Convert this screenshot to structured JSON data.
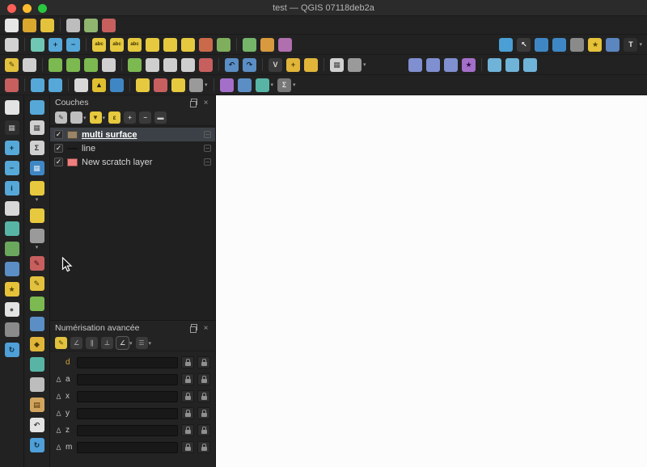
{
  "window": {
    "title": "test — QGIS 07118deb2a"
  },
  "ui": {
    "check": "✓",
    "close": "×",
    "dropdown_glyph": "▾"
  },
  "colors": {
    "selection": "#3c4147",
    "canvas": "#fcfcfc",
    "toolbar_bg": "#222222"
  },
  "toolbars": {
    "row1": [
      {
        "name": "new-project-icon",
        "color": "#e6e6e6"
      },
      {
        "name": "open-project-icon",
        "color": "#d9a62e"
      },
      {
        "name": "save-project-icon",
        "color": "#e4c23c"
      },
      {
        "sep": true
      },
      {
        "name": "new-print-layout-icon",
        "color": "#bdbdbd"
      },
      {
        "name": "layout-manager-icon",
        "color": "#8fb56f"
      },
      {
        "name": "style-manager-icon",
        "color": "#c75f5f"
      }
    ],
    "row2_left": [
      {
        "name": "data-source-manager-icon",
        "color": "#d2d2d2"
      },
      {
        "sep": true
      },
      {
        "name": "pan-map-icon",
        "color": "#6fc7b4"
      },
      {
        "name": "zoom-in-icon",
        "color": "#56a8d8",
        "glyph": "+",
        "fg": "#0c2a3a"
      },
      {
        "name": "zoom-out-icon",
        "color": "#56a8d8",
        "glyph": "−",
        "fg": "#0c2a3a"
      },
      {
        "sep": true
      },
      {
        "name": "layer-labeling-icon",
        "color": "#e6c93e",
        "glyph": "abc",
        "fg": "#3a3000"
      },
      {
        "name": "layer-diagram-icon",
        "color": "#e6c93e",
        "glyph": "abc",
        "fg": "#3a3000"
      },
      {
        "name": "highlight-labels-icon",
        "color": "#e6c93e",
        "glyph": "abc",
        "fg": "#3a3000"
      },
      {
        "name": "pin-labels-icon",
        "color": "#e6c93e"
      },
      {
        "name": "show-hide-labels-icon",
        "color": "#e6c93e"
      },
      {
        "name": "move-label-icon",
        "color": "#e6c93e"
      },
      {
        "name": "rotate-label-icon",
        "color": "#cb6a4a"
      },
      {
        "name": "change-label-icon",
        "color": "#7fae5c"
      },
      {
        "sep": true
      },
      {
        "name": "map-tips-icon",
        "color": "#74b56a"
      },
      {
        "name": "new-annotation-icon",
        "color": "#d99a3f"
      },
      {
        "name": "statistical-summary-icon",
        "color": "#b06fae"
      }
    ],
    "row2_right": [
      {
        "name": "processing-toolbox-icon",
        "color": "#4a9fd4"
      },
      {
        "name": "select-cursor-icon",
        "color": "#3a3a3a",
        "glyph": "↖",
        "fg": "#f0f0f0"
      },
      {
        "name": "select-features-icon",
        "color": "#3f87c4"
      },
      {
        "name": "select-by-form-icon",
        "color": "#3f87c4"
      },
      {
        "name": "deselect-all-icon",
        "color": "#8a8a8a"
      },
      {
        "name": "bookmark-star-icon",
        "color": "#e6c23a",
        "glyph": "★",
        "fg": "#5a4a00"
      },
      {
        "name": "python-console-icon",
        "color": "#5b86c0"
      },
      {
        "name": "text-annotation-icon",
        "color": "#2f2f2f",
        "glyph": "T",
        "fg": "#e8e8e8",
        "drop": true
      }
    ],
    "row3_left": [
      {
        "name": "toggle-editing-icon",
        "color": "#e2c13e",
        "glyph": "✎",
        "fg": "#4a3a00"
      },
      {
        "name": "save-edits-icon",
        "color": "#cfcfcf"
      },
      {
        "sep": true
      },
      {
        "name": "add-point-feature-icon",
        "color": "#7cb950"
      },
      {
        "name": "add-line-feature-icon",
        "color": "#7cb950"
      },
      {
        "name": "add-polygon-feature-icon",
        "color": "#7cb950"
      },
      {
        "name": "vertex-tool-icon",
        "color": "#d0d0d0"
      },
      {
        "sep": true
      },
      {
        "name": "move-feature-icon",
        "color": "#7cb950"
      },
      {
        "name": "copy-features-icon",
        "color": "#cfcfcf"
      },
      {
        "name": "cut-features-icon",
        "color": "#cfcfcf"
      },
      {
        "name": "paste-features-icon",
        "color": "#cfcfcf"
      },
      {
        "name": "delete-selected-icon",
        "color": "#c75f5f"
      },
      {
        "sep": true
      },
      {
        "name": "undo-icon",
        "color": "#5b8ec4",
        "glyph": "↶",
        "fg": "#0e2137"
      },
      {
        "name": "redo-icon",
        "color": "#5b8ec4",
        "glyph": "↷",
        "fg": "#0e2137"
      },
      {
        "sep": true
      },
      {
        "name": "vertex-editor-icon",
        "color": "#3a3a3a",
        "glyph": "V",
        "fg": "#d8d8d8"
      },
      {
        "name": "snapping-plus-icon",
        "color": "#e0b53a",
        "glyph": "+",
        "fg": "#4a3a00"
      },
      {
        "name": "tracing-icon",
        "color": "#e0b53a"
      },
      {
        "sep": true
      },
      {
        "name": "attribute-table-icon",
        "color": "#d0d0d0",
        "glyph": "▦",
        "fg": "#444444"
      },
      {
        "name": "layer-gear-icon",
        "color": "#9a9a9a",
        "drop": true
      }
    ],
    "row3_right": [
      {
        "name": "histogram-icon",
        "color": "#7f8fd0"
      },
      {
        "name": "bar-chart-icon",
        "color": "#7f8fd0"
      },
      {
        "name": "line-chart-icon",
        "color": "#7f8fd0"
      },
      {
        "name": "purple-star-icon",
        "color": "#a46fc8",
        "glyph": "★",
        "fg": "#2e0e48"
      },
      {
        "sep": true
      },
      {
        "name": "raster-stats-icon",
        "color": "#6fb3d8"
      },
      {
        "name": "raster-calc-icon",
        "color": "#6fb3d8"
      },
      {
        "name": "profile-tool-icon",
        "color": "#6fb3d8"
      }
    ],
    "row4": [
      {
        "name": "snapping-toggle-icon",
        "color": "#c75f5f"
      },
      {
        "sep": true
      },
      {
        "name": "zoom-next-icon",
        "color": "#56a8d8"
      },
      {
        "name": "zoom-last-icon",
        "color": "#56a8d8"
      },
      {
        "sep": true
      },
      {
        "name": "new-shapefile-icon",
        "color": "#d8d8d8"
      },
      {
        "name": "new-geopackage-icon",
        "color": "#e0c030",
        "glyph": "▲",
        "fg": "#222222"
      },
      {
        "name": "new-virtual-layer-icon",
        "color": "#3f87c4"
      },
      {
        "sep": true
      },
      {
        "name": "label-tool-icon",
        "color": "#e6c93e"
      },
      {
        "name": "diagram-tool-icon",
        "color": "#c75f5f"
      },
      {
        "name": "annotation-tool-icon",
        "color": "#e6c93e"
      },
      {
        "name": "form-annotation-icon",
        "color": "#9a9a9a",
        "drop": true
      },
      {
        "sep": true
      },
      {
        "name": "place-search-icon",
        "color": "#a46fc8"
      },
      {
        "name": "coordinate-capture-icon",
        "color": "#5b8ec4"
      },
      {
        "name": "measure-tool-icon",
        "color": "#58b5a5",
        "drop": true
      },
      {
        "name": "sum-tool-icon",
        "color": "#777777",
        "glyph": "Σ",
        "fg": "#dddddd",
        "drop": true
      }
    ]
  },
  "side_toolbar_1": [
    {
      "name": "pan-hand-icon",
      "color": "#e3e3e3"
    },
    {
      "name": "zoom-window-icon",
      "color": "#2f2f2f",
      "glyph": "▦",
      "fg": "#bbbbbb"
    },
    {
      "name": "zoom-in-mag-icon",
      "color": "#56a8d8",
      "glyph": "+",
      "fg": "#0c2a3a"
    },
    {
      "name": "zoom-out-mag-icon",
      "color": "#56a8d8",
      "glyph": "−",
      "fg": "#0c2a3a"
    },
    {
      "name": "identify-features-icon",
      "color": "#56a8d8",
      "glyph": "i",
      "fg": "#0c2a3a"
    },
    {
      "name": "select-rectangle-icon",
      "color": "#d8d8d8"
    },
    {
      "name": "measure-line-icon",
      "color": "#58b5a5"
    },
    {
      "name": "globe-green-icon",
      "color": "#6aa85e"
    },
    {
      "name": "globe-blue-icon",
      "color": "#5b8ec4"
    },
    {
      "name": "bookmark-icon",
      "color": "#e6c23a",
      "glyph": "★",
      "fg": "#5a4a00"
    },
    {
      "name": "temporal-clock-icon",
      "color": "#e3e3e3",
      "glyph": "●",
      "fg": "#555555"
    },
    {
      "name": "layers-db-icon",
      "color": "#8a8a8a"
    },
    {
      "name": "map-refresh-icon",
      "color": "#4f9fd8",
      "glyph": "↻",
      "fg": "#0c2a3a"
    }
  ],
  "side_toolbar_2": [
    {
      "name": "zoom-mag-2-icon",
      "color": "#56a8d8"
    },
    {
      "name": "attribute-table-2-icon",
      "color": "#d0d0d0",
      "glyph": "▦",
      "fg": "#444444"
    },
    {
      "name": "statistics-sum-icon",
      "color": "#d0d0d0",
      "glyph": "Σ",
      "fg": "#333333"
    },
    {
      "name": "blue-table-icon",
      "color": "#3f87c4",
      "glyph": "▦",
      "fg": "#dce9f5"
    },
    {
      "name": "callout-icon",
      "color": "#e6c93e",
      "drop": true
    },
    {
      "name": "map-tip-icon",
      "color": "#e6c93e"
    },
    {
      "name": "gear-icon",
      "color": "#9a9a9a",
      "drop": true
    },
    {
      "name": "edit-red-pencil-icon",
      "color": "#c75f5f",
      "glyph": "✎",
      "fg": "#3a0e0e"
    },
    {
      "name": "edit-yellow-pencil-icon",
      "color": "#e2c13e",
      "glyph": "✎",
      "fg": "#4a3a00"
    },
    {
      "name": "shape-green-icon",
      "color": "#7cb950"
    },
    {
      "name": "shape-blue-icon",
      "color": "#5b8ec4"
    },
    {
      "name": "diamond-icon",
      "color": "#e0b53a",
      "glyph": "◆",
      "fg": "#4a3a00"
    },
    {
      "name": "ruler-icon",
      "color": "#58b5a5"
    },
    {
      "name": "history-icon",
      "color": "#bdbdbd"
    },
    {
      "name": "clipboard-icon",
      "color": "#d2a55e",
      "glyph": "▤",
      "fg": "#4a2e00"
    },
    {
      "name": "undo-2-icon",
      "color": "#e3e3e3",
      "glyph": "↶",
      "fg": "#333333"
    },
    {
      "name": "redo-refresh-icon",
      "color": "#4f9fd8",
      "glyph": "↻",
      "fg": "#0c2a3a"
    }
  ],
  "layers_panel": {
    "title": "Couches",
    "toolbar": [
      {
        "name": "open-layer-styling-icon",
        "color": "#bfbfbf",
        "glyph": "✎",
        "fg": "#333333"
      },
      {
        "name": "manage-map-themes-icon",
        "color": "#bfbfbf",
        "drop": true
      },
      {
        "name": "filter-legend-icon",
        "color": "#e6c93e",
        "glyph": "▼",
        "fg": "#4a3a00",
        "drop": true
      },
      {
        "name": "filter-expression-icon",
        "color": "#e6c93e",
        "glyph": "ε",
        "fg": "#4a3a00"
      },
      {
        "name": "expand-all-icon",
        "color": "#3a3a3a",
        "glyph": "+",
        "fg": "#cccccc"
      },
      {
        "name": "collapse-all-icon",
        "color": "#3a3a3a",
        "glyph": "−",
        "fg": "#cccccc"
      },
      {
        "name": "remove-layer-icon",
        "color": "#3a3a3a",
        "glyph": "▬",
        "fg": "#cccccc"
      }
    ],
    "layers": [
      {
        "name": "multi surface",
        "check": "✓",
        "selected": true,
        "symbol_color": "#9b8568"
      },
      {
        "name": "line",
        "check": "✓",
        "selected": false,
        "symbol_color": "#141414"
      },
      {
        "name": "New scratch layer",
        "check": "✓",
        "selected": false,
        "symbol_color": "#ef7f7f"
      }
    ]
  },
  "digitizing_panel": {
    "title": "Numérisation avancée",
    "toolbar": [
      {
        "name": "enable-advanced-digitizing-icon",
        "color": "#e2c13e",
        "glyph": "✎",
        "fg": "#4a3a00"
      },
      {
        "name": "construction-mode-icon",
        "color": "#3a3a3a",
        "glyph": "∠",
        "fg": "#999999"
      },
      {
        "name": "parallel-icon",
        "color": "#3a3a3a",
        "glyph": "∥",
        "fg": "#999999"
      },
      {
        "name": "perpendicular-icon",
        "color": "#3a3a3a",
        "glyph": "⊥",
        "fg": "#999999"
      },
      {
        "name": "snap-common-angles-icon",
        "color": "#2b2b2b",
        "glyph": "∠",
        "fg": "#cccccc",
        "drop": true,
        "pressed": true
      },
      {
        "name": "construction-guides-icon",
        "color": "#3a3a3a",
        "glyph": "☰",
        "fg": "#999999",
        "drop": true
      }
    ],
    "rows": [
      {
        "label": "d",
        "delta_glyph": "",
        "value": ""
      },
      {
        "label": "a",
        "delta_glyph": "Δ",
        "value": ""
      },
      {
        "label": "x",
        "delta_glyph": "Δ",
        "value": ""
      },
      {
        "label": "y",
        "delta_glyph": "Δ",
        "value": ""
      },
      {
        "label": "z",
        "delta_glyph": "Δ",
        "value": ""
      },
      {
        "label": "m",
        "delta_glyph": "Δ",
        "value": ""
      }
    ]
  }
}
